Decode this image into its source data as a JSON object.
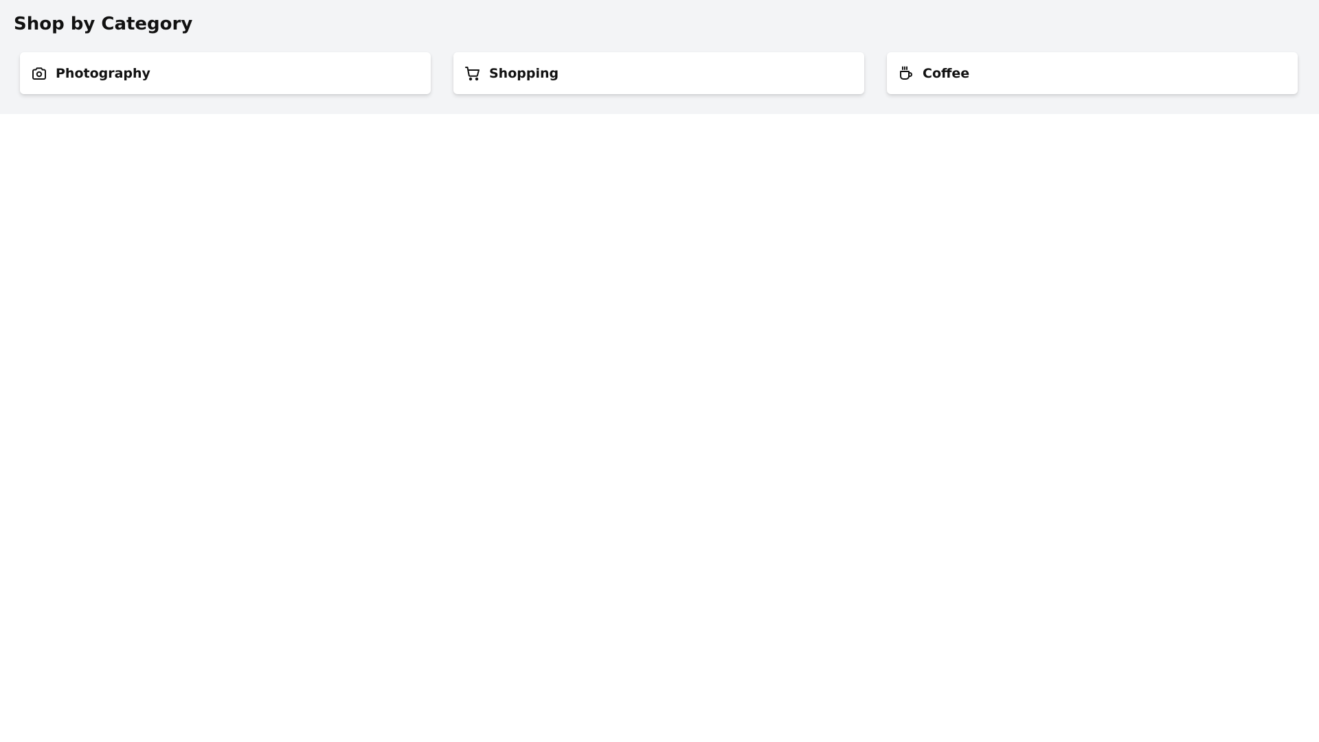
{
  "page": {
    "title": "Shop by Category"
  },
  "categories": [
    {
      "label": "Photography",
      "icon": "camera-icon"
    },
    {
      "label": "Shopping",
      "icon": "shopping-cart-icon"
    },
    {
      "label": "Coffee",
      "icon": "coffee-cup-icon"
    }
  ]
}
